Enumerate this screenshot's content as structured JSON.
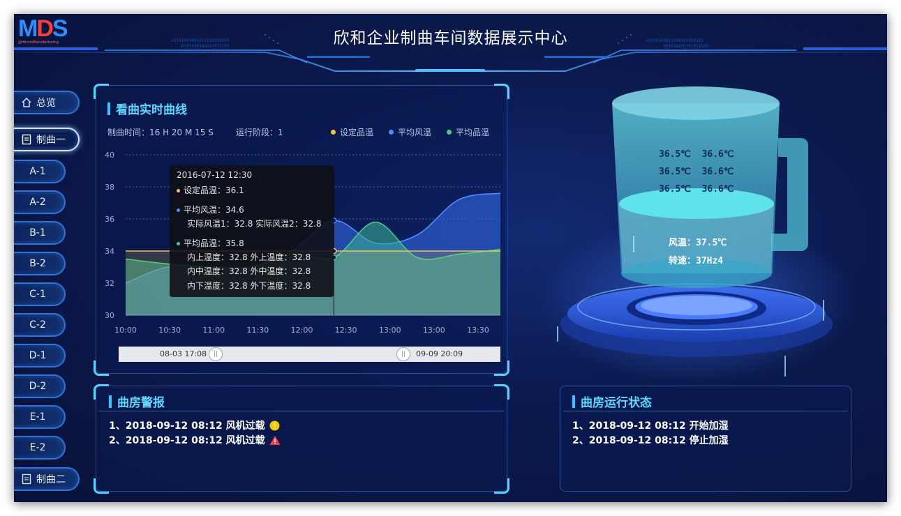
{
  "app": {
    "logo_text": "MDS",
    "logo_subtitle": "@HiintroManufacturing",
    "title": "欣和企业制曲车间数据展示中心"
  },
  "sidebar": {
    "items": [
      {
        "label": "总览",
        "icon": "home-icon"
      },
      {
        "label": "制曲一",
        "icon": "document-icon",
        "active": true
      },
      {
        "label": "A-1"
      },
      {
        "label": "A-2"
      },
      {
        "label": "B-1"
      },
      {
        "label": "B-2"
      },
      {
        "label": "C-1"
      },
      {
        "label": "C-2"
      },
      {
        "label": "D-1"
      },
      {
        "label": "D-2"
      },
      {
        "label": "E-1"
      },
      {
        "label": "E-2"
      },
      {
        "label": "制曲二",
        "icon": "document-icon"
      }
    ]
  },
  "curve_panel": {
    "title": "看曲实时曲线",
    "time_label": "制曲时间：16 H  20 M  15 S",
    "stage_label": "运行阶段：1"
  },
  "chart_data": {
    "type": "area",
    "x": [
      "10:00",
      "10:30",
      "11:00",
      "11:30",
      "12:00",
      "12:30",
      "13:00",
      "13:00",
      "13:30",
      "13:40"
    ],
    "xlabels": [
      "10:00",
      "10:30",
      "11:00",
      "11:30",
      "12:00",
      "12:30",
      "13:00",
      "13:00",
      "13:30"
    ],
    "ylim": [
      30,
      40
    ],
    "yticks": [
      "30",
      "32",
      "34",
      "36",
      "38",
      "40"
    ],
    "grid": true,
    "legend_position": "top-right",
    "series": [
      {
        "name": "设定品温",
        "color": "#f5c542",
        "values": [
          34,
          34,
          34,
          34,
          34,
          34,
          34,
          34,
          34,
          34
        ]
      },
      {
        "name": "平均风温",
        "color": "#4a8dff",
        "values": [
          32,
          33,
          33,
          33,
          34,
          35.9,
          34.5,
          35.0,
          37.2,
          37.6
        ]
      },
      {
        "name": "平均品温",
        "color": "#3ed084",
        "values": [
          33.5,
          33.2,
          33.0,
          33.0,
          33.8,
          33.6,
          35.8,
          33.6,
          33.8,
          34.1
        ]
      }
    ],
    "tooltip": {
      "time": "2016-07-12 12:30",
      "set_temp": "设定品温：36.1",
      "avg_air": "平均风温：34.6",
      "air_detail": "实际风温1：32.8  实际风温2：32.8",
      "avg_prod": "平均品温：35.8",
      "row1": "内上温度：32.8   外上温度：32.8",
      "row2": "内中温度：32.8   外中温度：32.8",
      "row3": "内下温度：32.8   外下温度：32.8"
    },
    "zoom": {
      "start": "08-03 17:08",
      "end": "09-09 20:09"
    }
  },
  "alarm_panel": {
    "title": "曲房警报",
    "items": [
      {
        "text": "1、2018-09-12 08:12  风机过载",
        "level": "warning",
        "icon": "warning-circle-icon",
        "color": "#f7c600"
      },
      {
        "text": "2、2018-09-12 08:12  风机过载",
        "level": "danger",
        "icon": "warning-triangle-icon",
        "color": "#ff3b3b"
      }
    ]
  },
  "status_panel": {
    "title": "曲房运行状态",
    "items": [
      {
        "text": "1、2018-09-12 08:12  开始加湿"
      },
      {
        "text": "2、2018-09-12 08:12  停止加湿"
      }
    ]
  },
  "cup": {
    "readings": [
      [
        "36.5℃",
        "36.6℃"
      ],
      [
        "36.5℃",
        "36.6℃"
      ],
      [
        "36.5℃",
        "36.6℃"
      ]
    ],
    "air_temp": "风温：37.5℃",
    "speed": "转速：37Hz4"
  }
}
